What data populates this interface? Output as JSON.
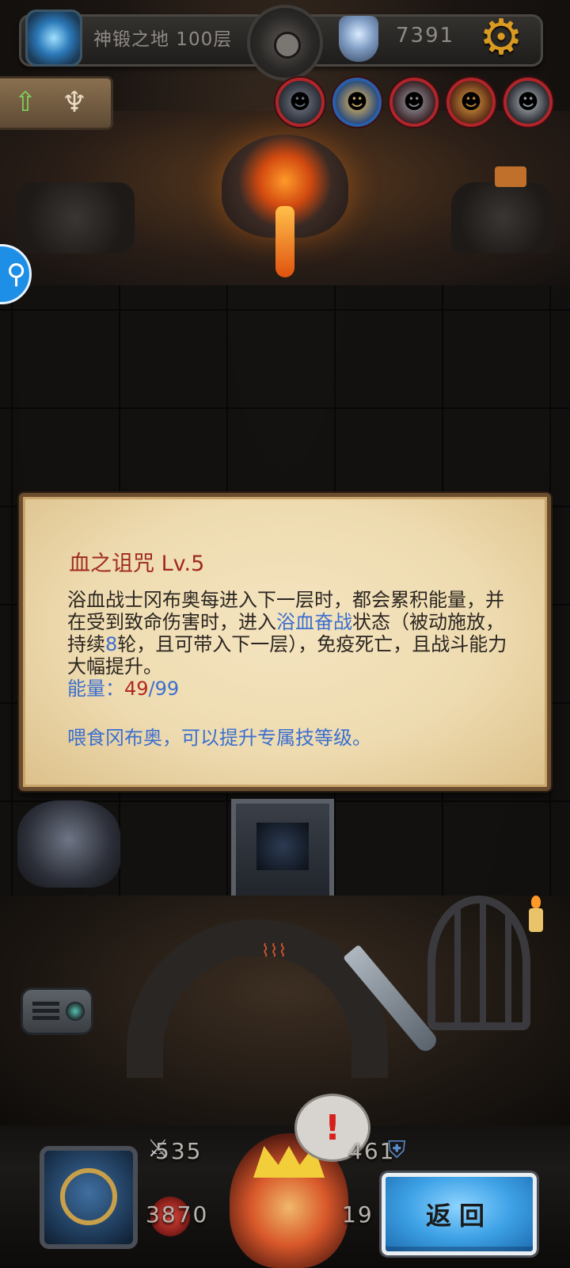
{
  "top_bar": {
    "portal_icon": "portal-icon",
    "floor_label": "神锻之地 100层",
    "center_icon": "eye-dial-icon",
    "gem_icon": "gem-icon",
    "gem_count": "7391",
    "settings_icon": "gear-icon"
  },
  "upgrade_plaque": {
    "arrow_icon": "up-arrow-icon",
    "trophy_icon": "trophy-icon"
  },
  "heroes": [
    {
      "name": "hero-1",
      "icon": "hero-portrait-icon"
    },
    {
      "name": "hero-2",
      "icon": "hero-portrait-icon"
    },
    {
      "name": "hero-3",
      "icon": "hero-portrait-icon"
    },
    {
      "name": "hero-4",
      "icon": "hero-portrait-icon"
    },
    {
      "name": "hero-5",
      "icon": "hero-portrait-icon"
    }
  ],
  "search_bubble": {
    "icon": "search-icon"
  },
  "skill_panel": {
    "title": "血之诅咒 Lv.5",
    "desc_part1": "浴血战士冈布奥每进入下一层时，都会累积能量，并在受到致命伤害时，进入",
    "desc_highlight1": "浴血奋战",
    "desc_part2": "状态（被动施放，持续",
    "desc_highlight2": "8",
    "desc_part3": "轮，且可带入下一层），免疫死亡，且战斗能力大幅提升。",
    "energy_label": "能量：",
    "energy_current": "49",
    "energy_sep": "/",
    "energy_max": "99",
    "feed_tip": "喂食冈布奥，可以提升专属技等级。"
  },
  "bottom_hud": {
    "attack_value": "535",
    "hp_value": "3870",
    "defense_value": "461",
    "extra_value": "19",
    "alert_symbol": "!",
    "back_label": "返回"
  },
  "colors": {
    "title_red": "#a02a1e",
    "highlight_blue": "#3b6fd0",
    "back_button_blue": "#3ea2e6",
    "parchment": "#eedbb0"
  }
}
